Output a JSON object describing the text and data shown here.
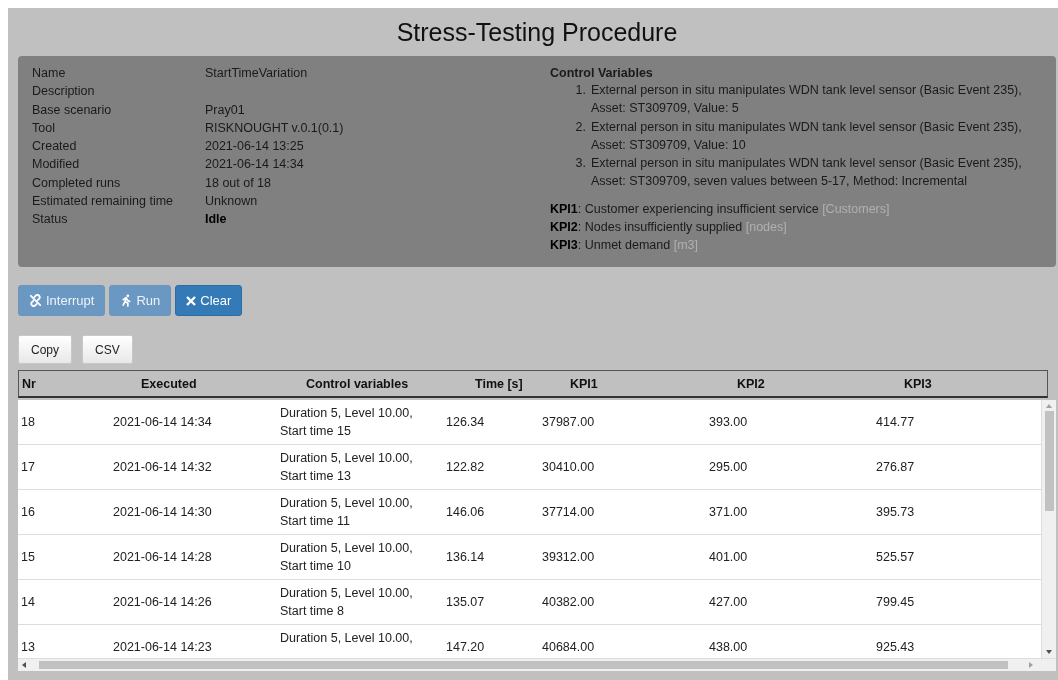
{
  "title": "Stress-Testing Procedure",
  "info": [
    {
      "label": "Name",
      "value": "StartTimeVariation",
      "bold": false
    },
    {
      "label": "Description"
    },
    {
      "label": "Base scenario",
      "value": "Pray01",
      "bold": false
    },
    {
      "label": "Tool",
      "value": "RISKNOUGHT v.0.1(0.1)",
      "bold": false
    },
    {
      "label": "Created",
      "value": "2021-06-14 13:25",
      "bold": false
    },
    {
      "label": "Modified",
      "value": "2021-06-14 14:34",
      "bold": false
    },
    {
      "label": "Completed runs",
      "value": "18 out of 18",
      "bold": false
    },
    {
      "label": "Estimated remaining time",
      "value": "Unknown",
      "bold": false
    },
    {
      "label": "Status",
      "value": "Idle",
      "bold": true
    }
  ],
  "control_variables": {
    "heading": "Control Variables",
    "items": [
      {
        "number": "1.",
        "text": "External person in situ manipulates WDN tank level sensor (Basic Event 235), Asset: ST309709, Value: 5"
      },
      {
        "number": "2.",
        "text": "External person in situ manipulates WDN tank level sensor (Basic Event 235), Asset: ST309709, Value: 10"
      },
      {
        "number": "3.",
        "text": "External person in situ manipulates WDN tank level sensor (Basic Event 235), Asset: ST309709, seven values between 5-17, Method: Incremental"
      }
    ]
  },
  "kpis": [
    {
      "text": "**KPI1**: Customer experiencing insufficient service",
      "unit": "[Customers]"
    },
    {
      "text": "**KPI2**: Nodes insufficiently supplied",
      "unit": "[nodes]"
    },
    {
      "text": "**KPI3**: Unmet demand",
      "unit": "[m3]"
    }
  ],
  "actions": [
    {
      "label": "Interrupt",
      "kind": "interrupt",
      "disabled": true
    },
    {
      "label": "Run",
      "kind": "run",
      "disabled": true
    },
    {
      "label": "Clear",
      "kind": "clear",
      "disabled": false
    }
  ],
  "export_buttons": [
    "Copy",
    "CSV"
  ],
  "table": {
    "columns": [
      "Nr",
      "Executed",
      "Control variables",
      "Time [s]",
      "KPI1",
      "KPI2",
      "KPI3"
    ],
    "rows": [
      [
        "18",
        "2021-06-14 14:34",
        "Duration 5, Level 10.00, Start time 15",
        "126.34",
        "37987.00",
        "393.00",
        "414.77"
      ],
      [
        "17",
        "2021-06-14 14:32",
        "Duration 5, Level 10.00, Start time 13",
        "122.82",
        "30410.00",
        "295.00",
        "276.87"
      ],
      [
        "16",
        "2021-06-14 14:30",
        "Duration 5, Level 10.00, Start time 11",
        "146.06",
        "37714.00",
        "371.00",
        "395.73"
      ],
      [
        "15",
        "2021-06-14 14:28",
        "Duration 5, Level 10.00, Start time 10",
        "136.14",
        "39312.00",
        "401.00",
        "525.57"
      ],
      [
        "14",
        "2021-06-14 14:26",
        "Duration 5, Level 10.00, Start time 8",
        "135.07",
        "40382.00",
        "427.00",
        "799.45"
      ],
      [
        "13",
        "2021-06-14 14:23",
        "Duration 5, Level 10.00,",
        "147.20",
        "40684.00",
        "438.00",
        "925.43"
      ]
    ]
  }
}
